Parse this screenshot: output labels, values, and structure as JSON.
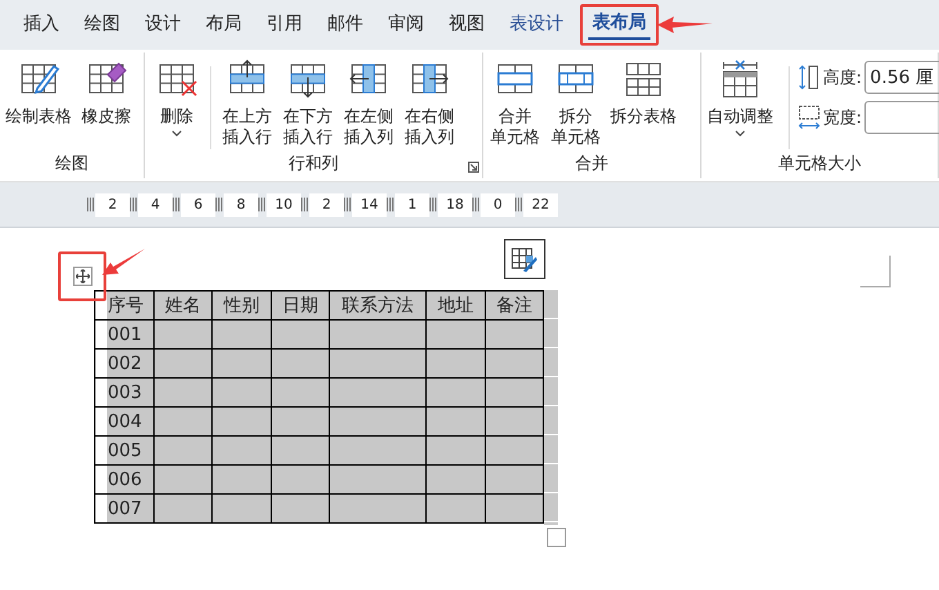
{
  "tabs": [
    {
      "label": "插入",
      "selected": false
    },
    {
      "label": "绘图",
      "selected": false
    },
    {
      "label": "设计",
      "selected": false
    },
    {
      "label": "布局",
      "selected": false
    },
    {
      "label": "引用",
      "selected": false
    },
    {
      "label": "邮件",
      "selected": false
    },
    {
      "label": "审阅",
      "selected": false
    },
    {
      "label": "视图",
      "selected": false
    },
    {
      "label": "表设计",
      "selected": false
    },
    {
      "label": "表布局",
      "selected": true
    }
  ],
  "ribbon": {
    "groups": [
      {
        "label": "绘图",
        "launcher": false,
        "buttons": [
          {
            "lines": [
              "绘制表格"
            ],
            "dropdown": false
          },
          {
            "lines": [
              "橡皮擦"
            ],
            "dropdown": false
          }
        ]
      },
      {
        "label": "行和列",
        "launcher": true,
        "buttons": [
          {
            "lines": [
              "删除"
            ],
            "dropdown": true
          },
          {
            "lines": [
              "在上方",
              "插入行"
            ],
            "dropdown": false
          },
          {
            "lines": [
              "在下方",
              "插入行"
            ],
            "dropdown": false
          },
          {
            "lines": [
              "在左侧",
              "插入列"
            ],
            "dropdown": false
          },
          {
            "lines": [
              "在右侧",
              "插入列"
            ],
            "dropdown": false
          }
        ]
      },
      {
        "label": "合并",
        "launcher": false,
        "buttons": [
          {
            "lines": [
              "合并",
              "单元格"
            ],
            "dropdown": false
          },
          {
            "lines": [
              "拆分",
              "单元格"
            ],
            "dropdown": false
          },
          {
            "lines": [
              "拆分表格"
            ],
            "dropdown": false
          }
        ]
      },
      {
        "label": "单元格大小",
        "launcher": false,
        "buttons": [
          {
            "lines": [
              "自动调整"
            ],
            "dropdown": true
          }
        ],
        "fields": [
          {
            "label": "高度:",
            "value": "0.56 厘"
          },
          {
            "label": "宽度:"
          }
        ]
      }
    ]
  },
  "ruler": [
    "2",
    "4",
    "6",
    "8",
    "10",
    "2",
    "14",
    "1",
    "18",
    "0",
    "22"
  ],
  "table": {
    "columns": [
      "序号",
      "姓名",
      "性别",
      "日期",
      "联系方法",
      "地址",
      "备注"
    ],
    "rows": [
      [
        "001",
        "",
        "",
        "",
        "",
        "",
        ""
      ],
      [
        "002",
        "",
        "",
        "",
        "",
        "",
        ""
      ],
      [
        "003",
        "",
        "",
        "",
        "",
        "",
        ""
      ],
      [
        "004",
        "",
        "",
        "",
        "",
        "",
        ""
      ],
      [
        "005",
        "",
        "",
        "",
        "",
        "",
        ""
      ],
      [
        "006",
        "",
        "",
        "",
        "",
        "",
        ""
      ],
      [
        "007",
        "",
        "",
        "",
        "",
        "",
        ""
      ]
    ]
  }
}
